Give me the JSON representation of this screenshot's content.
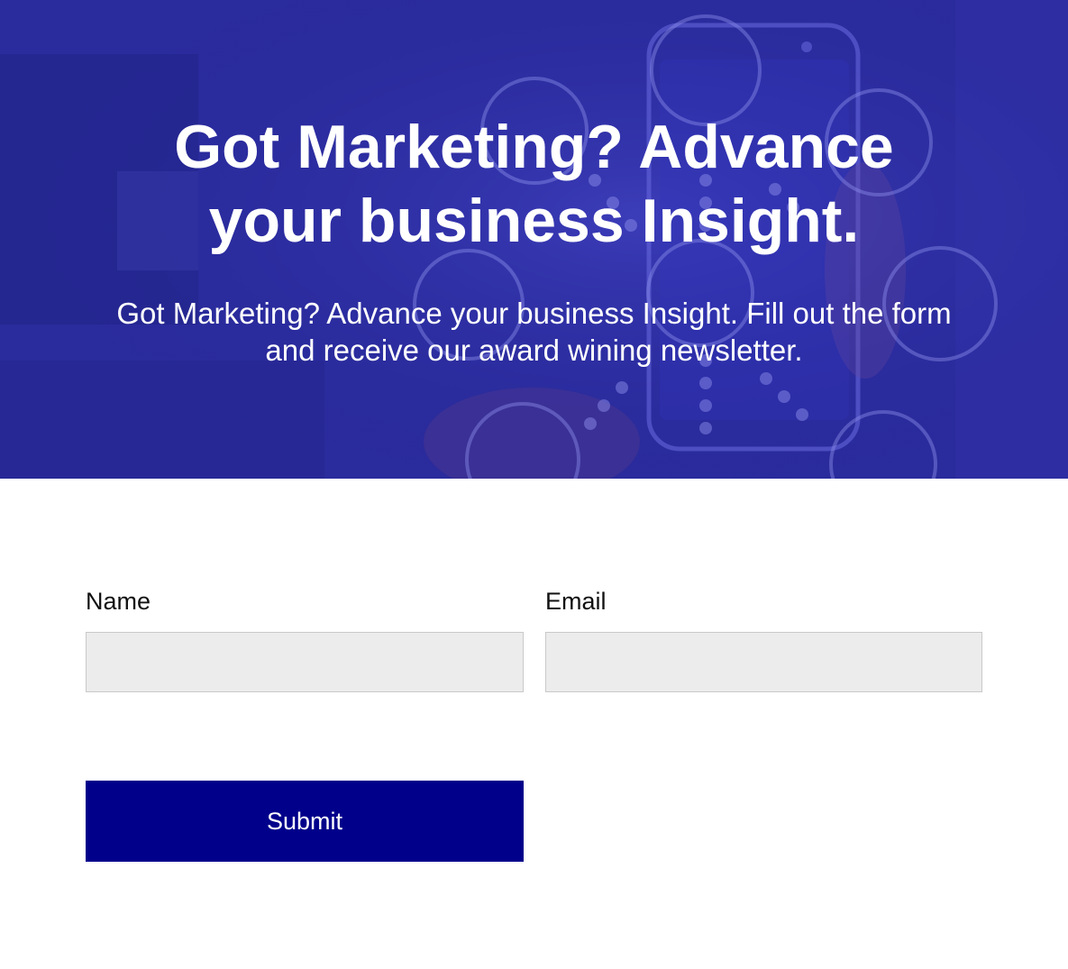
{
  "hero": {
    "title": "Got Marketing? Advance your business Insight.",
    "subtitle": "Got Marketing? Advance your business Insight. Fill out the form and receive our award wining newsletter.",
    "overlay_color": "#2a2b9c"
  },
  "form": {
    "name_label": "Name",
    "name_value": "",
    "email_label": "Email",
    "email_value": "",
    "submit_label": "Submit",
    "button_color": "#00008b",
    "input_bg": "#ececec"
  }
}
